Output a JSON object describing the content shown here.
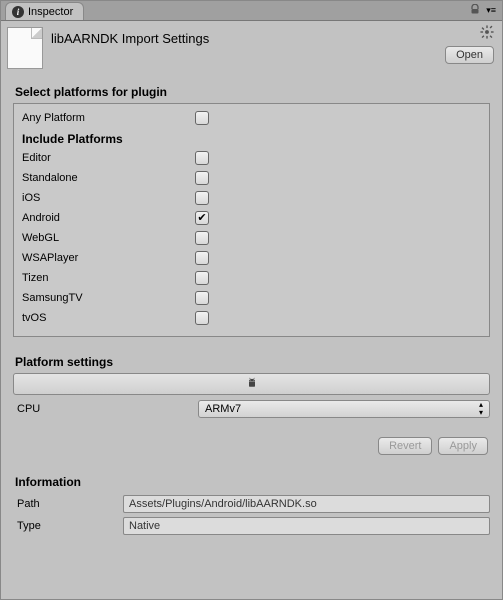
{
  "tab": {
    "label": "Inspector"
  },
  "header": {
    "title": "libAARNDK Import Settings",
    "open_label": "Open"
  },
  "platforms": {
    "section_title": "Select platforms for plugin",
    "any_label": "Any Platform",
    "any_checked": false,
    "include_title": "Include Platforms",
    "items": [
      {
        "label": "Editor",
        "checked": false
      },
      {
        "label": "Standalone",
        "checked": false
      },
      {
        "label": "iOS",
        "checked": false
      },
      {
        "label": "Android",
        "checked": true
      },
      {
        "label": "WebGL",
        "checked": false
      },
      {
        "label": "WSAPlayer",
        "checked": false
      },
      {
        "label": "Tizen",
        "checked": false
      },
      {
        "label": "SamsungTV",
        "checked": false
      },
      {
        "label": "tvOS",
        "checked": false
      }
    ]
  },
  "platform_settings": {
    "section_title": "Platform settings",
    "cpu_label": "CPU",
    "cpu_value": "ARMv7"
  },
  "actions": {
    "revert_label": "Revert",
    "apply_label": "Apply"
  },
  "information": {
    "section_title": "Information",
    "path_label": "Path",
    "path_value": "Assets/Plugins/Android/libAARNDK.so",
    "type_label": "Type",
    "type_value": "Native"
  }
}
